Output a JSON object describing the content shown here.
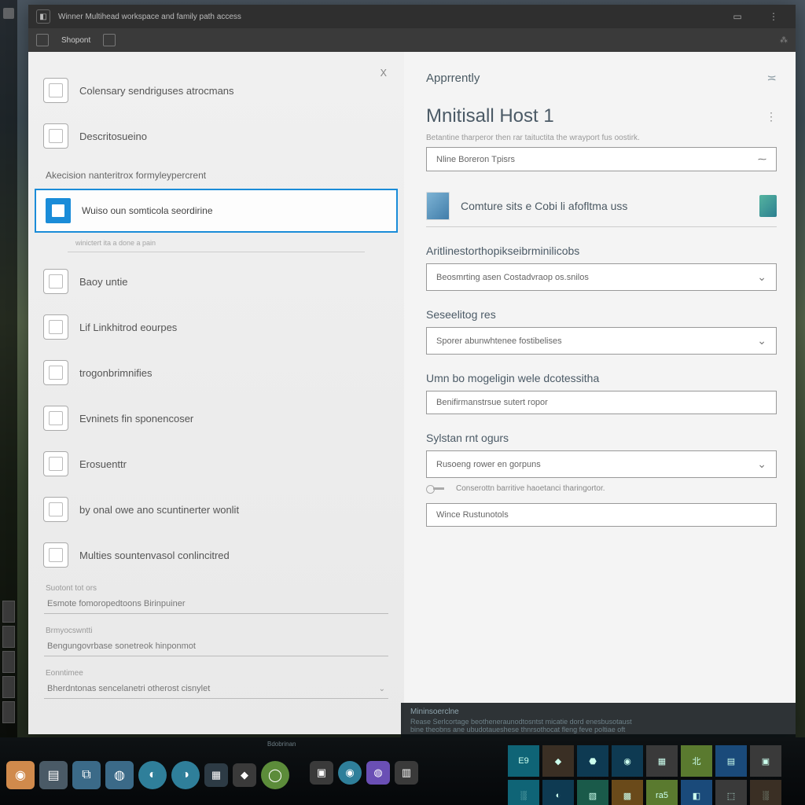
{
  "titlebar": {
    "title": "Winner Multihead workspace and family path access"
  },
  "tabbar": {
    "tab1": "Shopont"
  },
  "left": {
    "close": "X",
    "items": [
      {
        "label": "Colensary sendriguses atrocmans"
      },
      {
        "label": "Descritosueino"
      }
    ],
    "subhead": "Akecision nanteritrox formyleypercrent",
    "highlighted": {
      "label": "Wuiso oun somticola seordirine"
    },
    "tiny": "winictert ita a done a pain",
    "rest": [
      {
        "label": "Baoy untie"
      },
      {
        "label": "Lif Linkhitrod eourpes"
      },
      {
        "label": "trogonbrimnifies"
      },
      {
        "label": "Evninets fin sponencoser"
      },
      {
        "label": "Erosuenttr"
      },
      {
        "label": "by onal owe ano scuntinerter wonlit"
      },
      {
        "label": "Multies sountenvasol conlincitred"
      }
    ],
    "footer": [
      {
        "hint": "Suotont tot ors",
        "text": "Esmote fomoropedtoons Birinpuiner"
      },
      {
        "hint": "Brmyocswntti",
        "text": "Bengungovrbase sonetreok hinponmot"
      },
      {
        "hint": "Eonntimee",
        "text": "Bherdntonas sencelanetri otherost cisnylet"
      }
    ]
  },
  "right": {
    "crumb": "Apprrently",
    "title": "Mnitisall Host 1",
    "desc": "Betantine tharperor then rar taituctita the wrayport fus oostirk.",
    "host_input": "Nline Boreron Tpisrs",
    "infobar": "Comture sits e Cobi li afofltma uss",
    "sections": [
      {
        "head": "Aritlinestorthopikseibrminilicobs",
        "sel": "Beosmrting asen Costadvraop os.snilos"
      },
      {
        "head": "Seseelitog res",
        "sel": "Sporer abunwhtenee fostibelises"
      },
      {
        "head": "Umn bo mogeligin wele dcotessitha",
        "sel": "Benifirmanstrsue sutert ropor"
      },
      {
        "head": "Sylstan rnt ogurs",
        "sel": "Rusoeng rower en gorpuns",
        "note": "Conserottn barritive haoetanci tharingortor.",
        "extra": "Wince Rustunotols"
      }
    ]
  },
  "taskbar": {
    "label": "Bdobrinan"
  },
  "darkstrip": {
    "h": "Mininsoerclne",
    "l1": "Rease Serlcortage beotheneraunodtosntst micatie dord enesbusotaust",
    "l2": "bine theobns ane ubudotaueshese thnrsothocat fleng feve poltiae oft"
  }
}
